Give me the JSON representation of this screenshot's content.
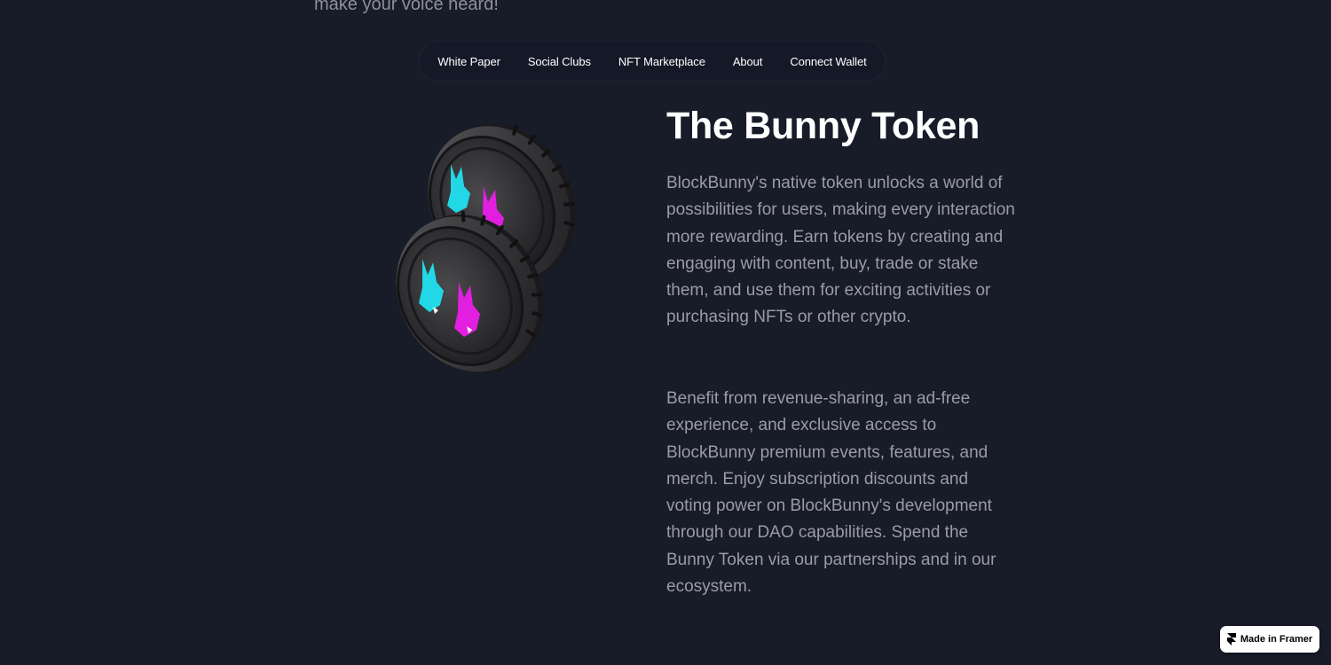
{
  "hero": {
    "tagline_fragment": "make your voice heard!"
  },
  "nav": {
    "items": [
      {
        "label": "White Paper"
      },
      {
        "label": "Social Clubs"
      },
      {
        "label": "NFT Marketplace"
      },
      {
        "label": "About"
      },
      {
        "label": "Connect Wallet"
      }
    ]
  },
  "token_section": {
    "title": "The Bunny Token",
    "paragraph1": "BlockBunny's native token unlocks a world of possibilities for users, making every interaction more rewarding. Earn tokens by creating and engaging with content, buy, trade or stake them, and use them for exciting activities or purchasing NFTs or other crypto.",
    "paragraph2": "Benefit from revenue-sharing, an ad-free experience, and exclusive access to BlockBunny premium events, features, and merch. Enjoy subscription discounts and voting power on BlockBunny's development through our DAO capabilities.  Spend the Bunny Token via our partnerships and in our ecosystem."
  },
  "badge": {
    "label": "Made in Framer",
    "icon": "framer-logo-icon"
  },
  "colors": {
    "background": "#181b28",
    "nav_background": "#151827",
    "body_text": "#9a9ca6",
    "cyan_bunny": "#22d8e6",
    "magenta_bunny": "#e21fe0"
  }
}
